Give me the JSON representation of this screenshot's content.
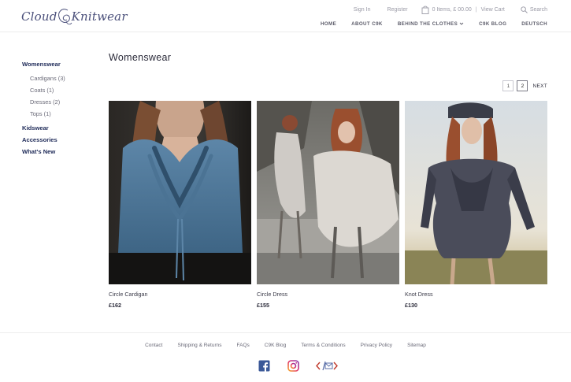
{
  "brand": {
    "logo_left": "Cloud",
    "logo_right": "Knitwear",
    "logo_color": "#4a4f7a"
  },
  "utility": {
    "signin": "Sign In",
    "register": "Register",
    "cart": "0 Items, £ 00.00",
    "separator": "|",
    "view_cart": "View Cart",
    "search": "Search"
  },
  "nav": {
    "home": "HOME",
    "about": "ABOUT C9K",
    "behind": "BEHIND THE CLOTHES",
    "blog": "C9K BLOG",
    "deutsch": "DEUTSCH"
  },
  "sidebar": {
    "womenswear": "Womenswear",
    "subitems": [
      "Cardigans (3)",
      "Coats (1)",
      "Dresses (2)",
      "Tops (1)"
    ],
    "kidswear": "Kidswear",
    "accessories": "Accessories",
    "whats_new": "What's New"
  },
  "main": {
    "title": "Womenswear",
    "pager": {
      "pages": [
        "1",
        "2"
      ],
      "current": "2",
      "next": "NEXT"
    },
    "products": [
      {
        "name": "Circle Cardigan",
        "price": "£162",
        "image": "blue-knit-cardigan-photo"
      },
      {
        "name": "Circle Dress",
        "price": "£155",
        "image": "grey-circle-dress-photo"
      },
      {
        "name": "Knot Dress",
        "price": "£130",
        "image": "charcoal-knot-dress-photo"
      }
    ]
  },
  "footer": {
    "links": [
      "Contact",
      "Shipping & Returns",
      "FAQs",
      "C9K Blog",
      "Terms & Conditions",
      "Privacy Policy",
      "Sitemap"
    ],
    "socials": [
      "facebook-icon",
      "instagram-icon",
      "code-mail-icon"
    ]
  },
  "colors": {
    "accent_navy": "#1e2a58",
    "facebook": "#3b5998",
    "instagram": "#d6249f",
    "code_icon": "#c0392b"
  }
}
